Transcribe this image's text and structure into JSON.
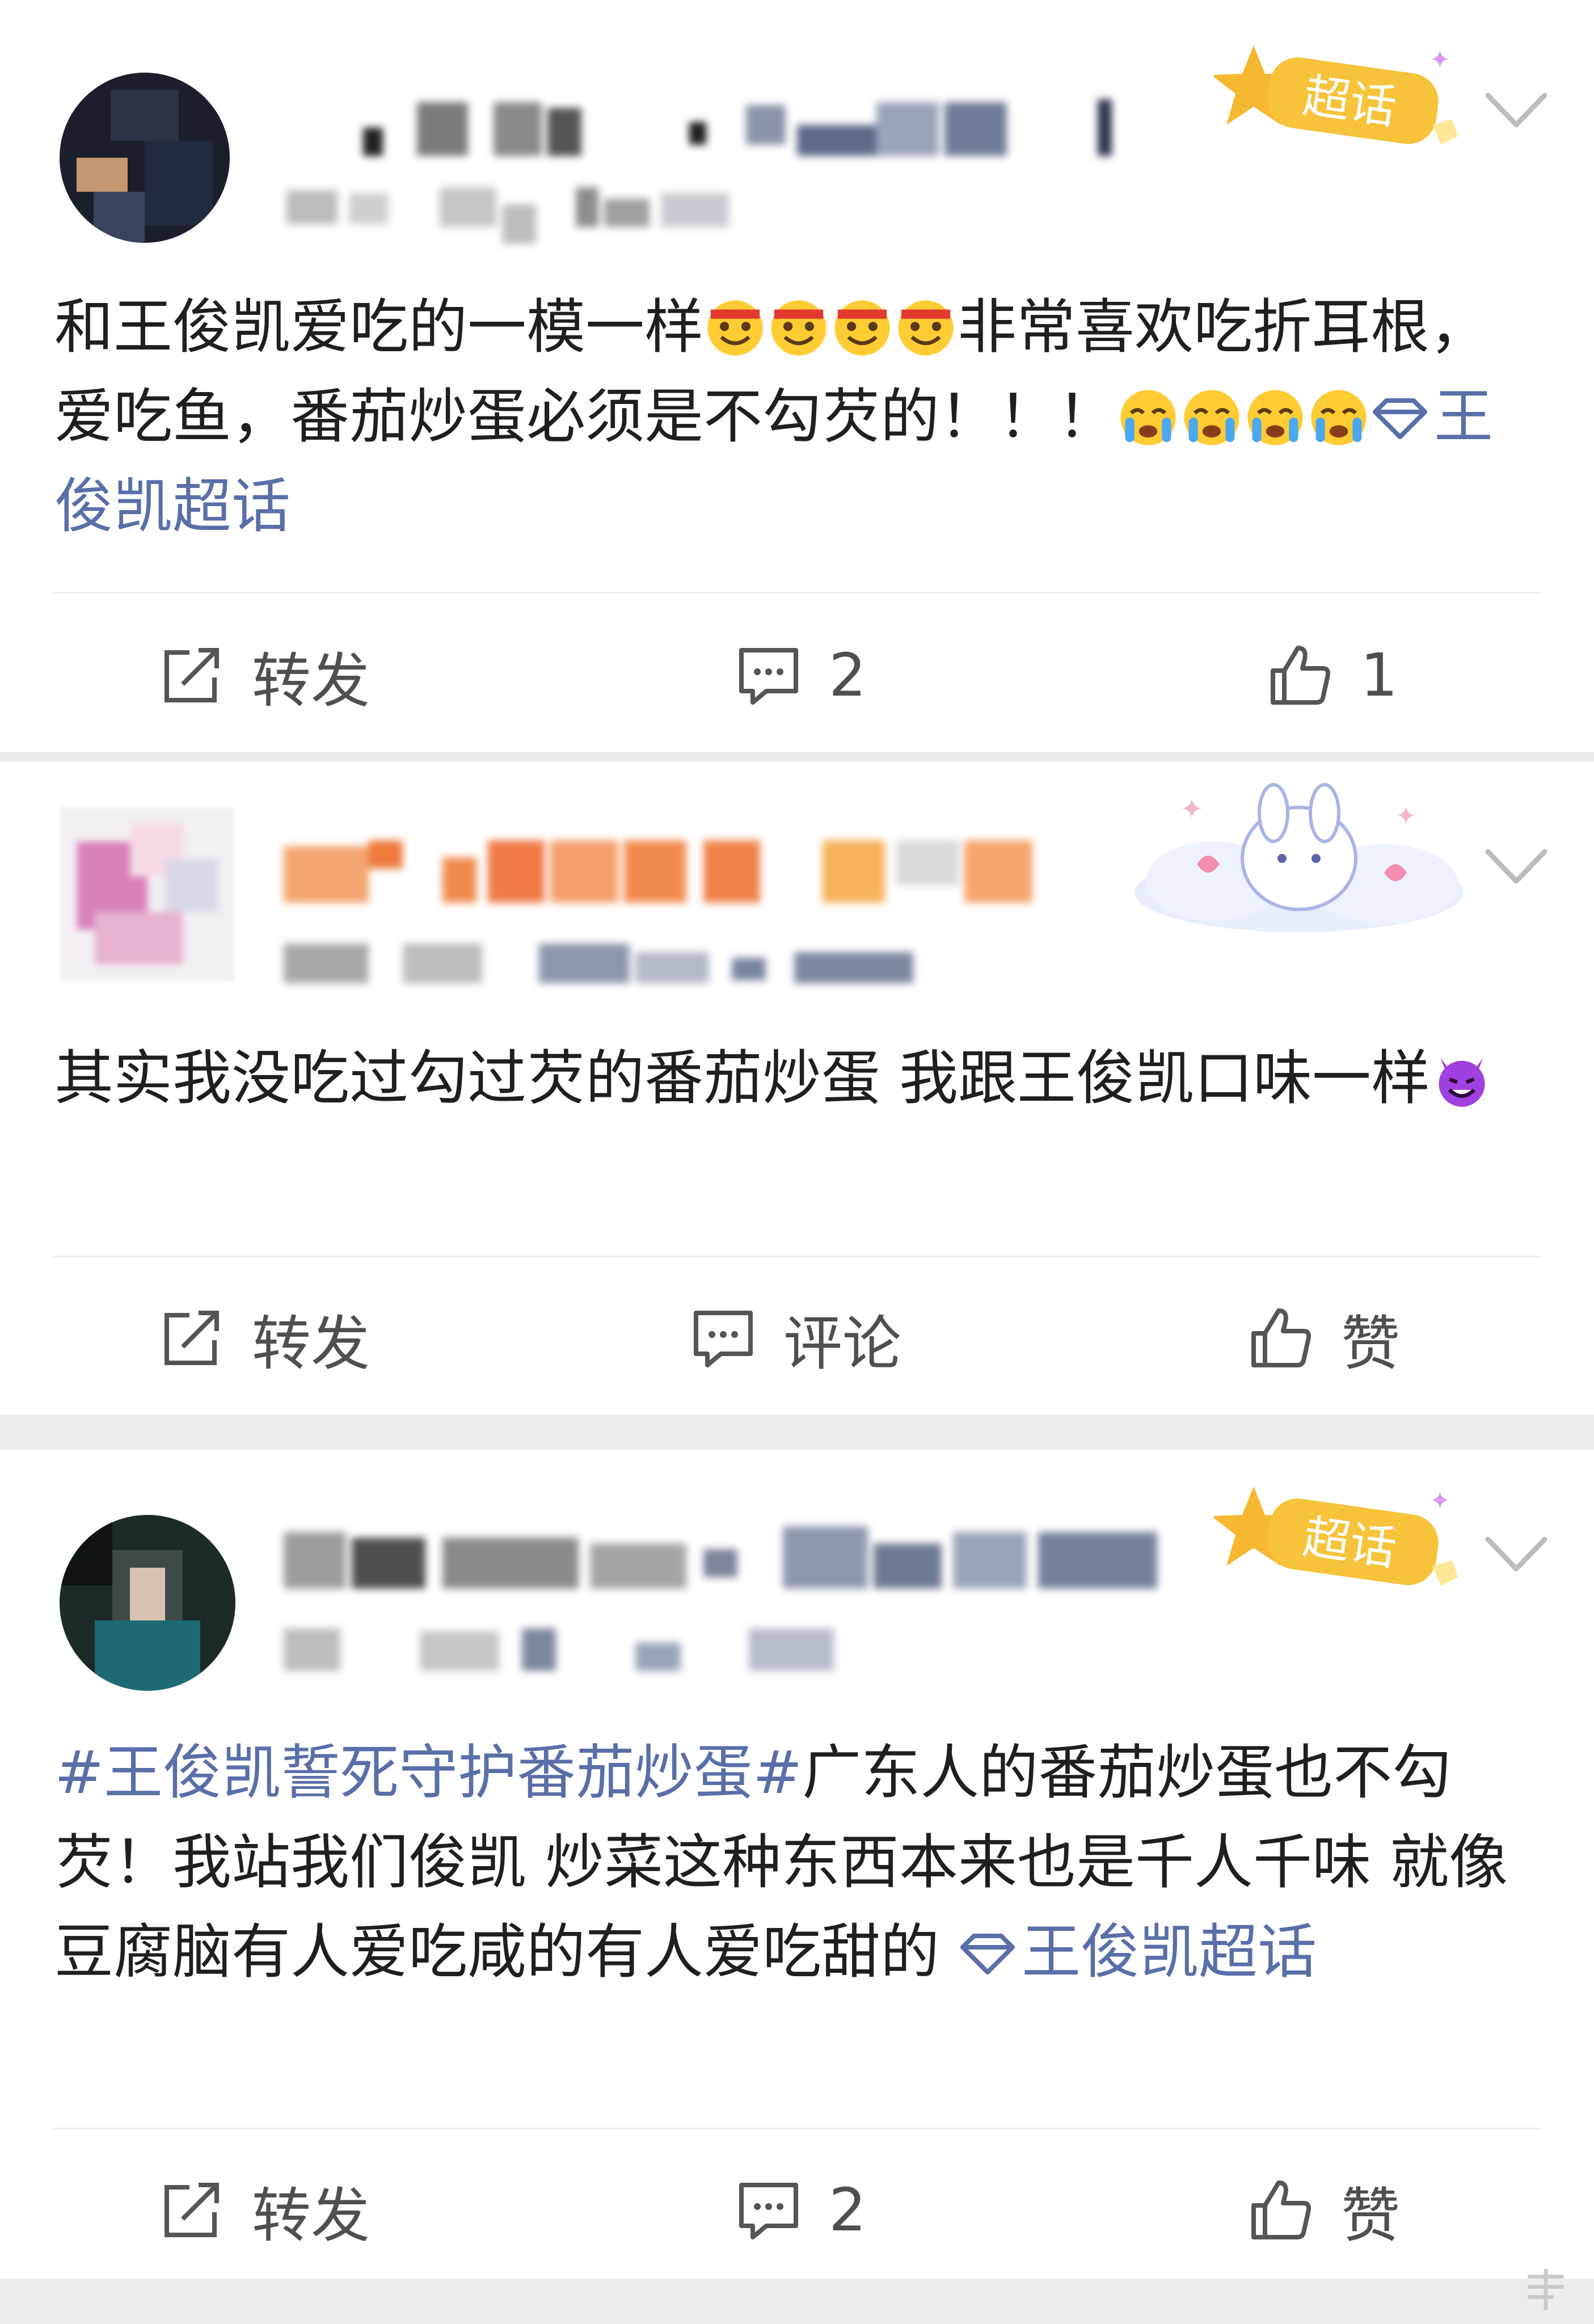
{
  "posts": [
    {
      "content_text": "和王俊凯爱吃的一模一样",
      "content_text_2": "非常喜欢吃折耳根，爱吃鱼，番茄炒蛋必须是不勾芡的！！！",
      "topic_label": "王俊凯超话",
      "badge_text": "超话",
      "actions": {
        "repost_label": "转发",
        "comment_count": "2",
        "like_count": "1"
      }
    },
    {
      "content_text": "其实我没吃过勾过芡的番茄炒蛋 我跟王俊凯口味一样",
      "actions": {
        "repost_label": "转发",
        "comment_label": "评论",
        "like_label": "赞"
      }
    },
    {
      "hashtag": "#王俊凯誓死守护番茄炒蛋#",
      "content_text": "广东人的番茄炒蛋也不勾芡！我站我们俊凯 炒菜这种东西本来也是千人千味 就像豆腐脑有人爱吃咸的有人爱吃甜的",
      "topic_label": "王俊凯超话",
      "badge_text": "超话",
      "actions": {
        "repost_label": "转发",
        "comment_count": "2",
        "like_label": "赞"
      }
    }
  ],
  "colors": {
    "link": "#5a6ea8",
    "badge": "#f6c33a",
    "separator": "#ededf0"
  }
}
